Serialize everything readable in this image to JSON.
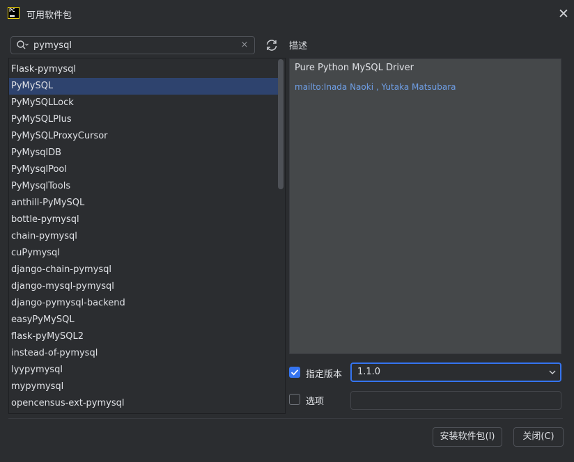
{
  "window": {
    "title": "可用软件包",
    "app_icon_text": "PC",
    "app_icon": "pycharm-icon",
    "close_icon": "close-icon"
  },
  "search": {
    "value": "pymysql",
    "placeholder": "",
    "search_icon": "search-icon",
    "clear_icon": "clear-icon",
    "clear_glyph": "×",
    "refresh_icon": "refresh-icon"
  },
  "packages": {
    "selected_index": 1,
    "items": [
      "Flask-pymysql",
      "PyMySQL",
      "PyMySQLLock",
      "PyMySQLPlus",
      "PyMySQLProxyCursor",
      "PyMysqlDB",
      "PyMysqlPool",
      "PyMysqlTools",
      "anthill-PyMySQL",
      "bottle-pymysql",
      "chain-pymysql",
      "cuPymysql",
      "django-chain-pymysql",
      "django-mysql-pymysql",
      "django-pymysql-backend",
      "easyPyMySQL",
      "flask-pyMySQL2",
      "instead-of-pymysql",
      "lyypymysql",
      "mypymysql",
      "opencensus-ext-pymysql"
    ]
  },
  "description": {
    "label": "描述",
    "summary": "Pure Python MySQL Driver",
    "link_text": "mailto:Inada Naoki , Yutaka Matsubara"
  },
  "version": {
    "checkbox_label": "指定版本",
    "checked": true,
    "selected": "1.1.0",
    "chevron_icon": "chevron-down-icon"
  },
  "options": {
    "checkbox_label": "选项",
    "checked": false,
    "value": ""
  },
  "buttons": {
    "install": "安装软件包(I)",
    "close": "关闭(C)"
  },
  "colors": {
    "background": "#2b2d30",
    "selection": "#2e436e",
    "accent": "#3574f0",
    "description_bg": "#45484a",
    "link": "#6f9fe6"
  }
}
